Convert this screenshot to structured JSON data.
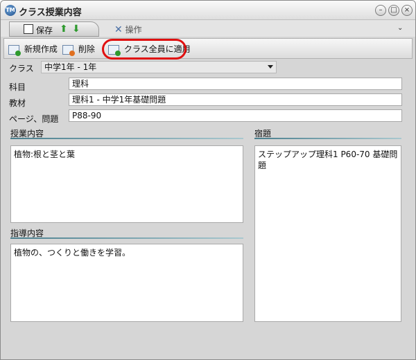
{
  "window": {
    "title": "クラス授業内容"
  },
  "tabs": {
    "save_label": "保存",
    "operations_label": "操作"
  },
  "toolbar": {
    "new_label": "新規作成",
    "delete_label": "削除",
    "apply_all_label": "クラス全員に適用"
  },
  "form": {
    "class_label": "クラス",
    "class_value": "中学1年 - 1年",
    "subject_label": "科目",
    "subject_value": "理科",
    "material_label": "教材",
    "material_value": "理科1 - 中学1年基礎問題",
    "page_label": "ページ、問題",
    "page_value": "P88-90"
  },
  "sections": {
    "lesson_title": "授業内容",
    "lesson_text": "植物:根と茎と葉",
    "guidance_title": "指導内容",
    "guidance_text": "植物の、つくりと働きを学習。",
    "homework_title": "宿題",
    "homework_text": "ステップアップ理科1  P60-70  基礎問題"
  },
  "colors": {
    "highlight": "#e01010",
    "section_line": "#4a7f8e"
  }
}
